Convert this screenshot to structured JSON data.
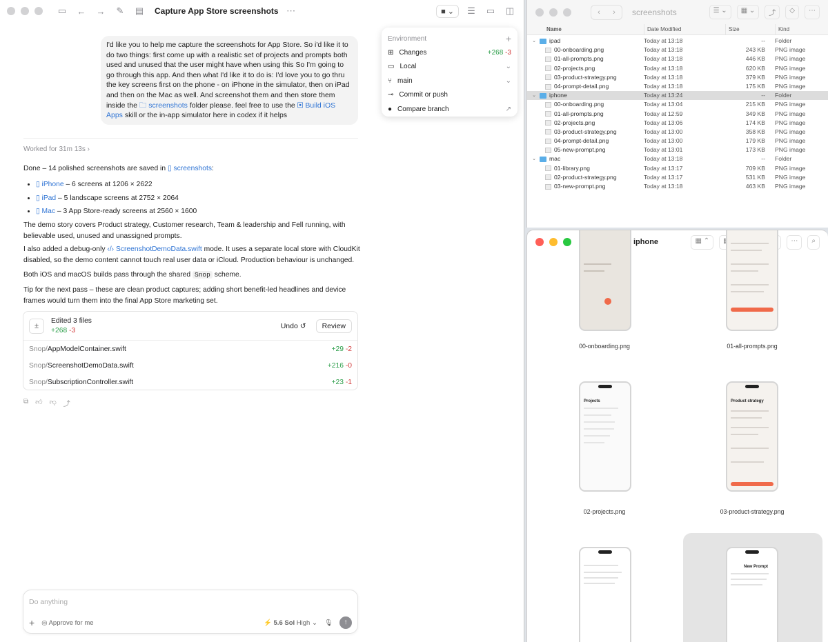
{
  "codex": {
    "window_title": "Capture App Store screenshots",
    "user_message": "I'd like you to help me capture the screenshots for App Store. So i'd like it to do two things: first come up with a realistic set of projects and prompts both used and unused that the user might have when using this So I'm going to go through this app. And then what I'd like it to do is: I'd love you to go thru the key screens first on the phone - on iPhone in the simulator, then on iPad and then on the Mac as well. And screenshot them and then store them inside the",
    "user_folder_chip": "screenshots",
    "user_message_2": "folder please. feel free to use the",
    "user_skill_chip": "Build iOS Apps",
    "user_message_3": "skill or the in-app simulator here in codex if it helps",
    "environment": {
      "header": "Environment",
      "rows": [
        {
          "icon": "changes-icon",
          "label": "Changes",
          "added": "+268",
          "removed": "-3"
        },
        {
          "icon": "laptop-icon",
          "label": "Local",
          "right": "⌄"
        },
        {
          "icon": "branch-icon",
          "label": "main",
          "right": "⌄"
        },
        {
          "icon": "commit-icon",
          "label": "Commit or push",
          "right": ""
        },
        {
          "icon": "github-icon",
          "label": "Compare branch",
          "right": "↗"
        }
      ]
    },
    "worked_for": "Worked for 31m 13s",
    "done_prefix": "Done – 14 polished screenshots are saved in",
    "done_folder": "screenshots",
    "done_suffix": ":",
    "bullets": [
      {
        "link": "iPhone",
        "text": "– 6 screens at 1206 × 2622"
      },
      {
        "link": "iPad",
        "text": "– 5 landscape screens at 2752 × 2064"
      },
      {
        "link": "Mac",
        "text": "– 3 App Store-ready screens at 2560 × 1600"
      }
    ],
    "para_demo": "The demo story covers Product strategy, Customer research, Team & leadership and Fell running, with believable used, unused and unassigned prompts.",
    "para_debug_1": "I also added a debug-only",
    "para_debug_link": "ScreenshotDemoData.swift",
    "para_debug_2": "mode. It uses a separate local store with CloudKit disabled, so the demo content cannot touch real user data or iCloud. Production behaviour is unchanged.",
    "para_builds_1": "Both iOS and macOS builds pass through the shared",
    "para_builds_code": "Snop",
    "para_builds_2": "scheme.",
    "para_tip": "Tip for the next pass – these are clean product captures; adding short benefit-led headlines and device frames would turn them into the final App Store marketing set.",
    "edits": {
      "title": "Edited 3 files",
      "added": "+268",
      "removed": "-3",
      "undo": "Undo",
      "review": "Review",
      "files": [
        {
          "dir": "Snop/",
          "name": "AppModelContainer.swift",
          "added": "+29",
          "removed": "-2"
        },
        {
          "dir": "Snop/",
          "name": "ScreenshotDemoData.swift",
          "added": "+216",
          "removed": "-0"
        },
        {
          "dir": "Snop/",
          "name": "SubscriptionController.swift",
          "added": "+23",
          "removed": "-1"
        }
      ]
    },
    "composer": {
      "placeholder": "Do anything",
      "approve": "Approve for me",
      "model": "5.6 Sol",
      "effort": "High"
    }
  },
  "finder_list": {
    "title": "screenshots",
    "columns": [
      "Name",
      "Date Modified",
      "Size",
      "Kind"
    ],
    "rows": [
      {
        "level": 0,
        "folder": true,
        "name": "ipad",
        "date": "Today at 13:18",
        "size": "--",
        "kind": "Folder"
      },
      {
        "level": 1,
        "folder": false,
        "name": "00-onboarding.png",
        "date": "Today at 13:18",
        "size": "243 KB",
        "kind": "PNG image"
      },
      {
        "level": 1,
        "folder": false,
        "name": "01-all-prompts.png",
        "date": "Today at 13:18",
        "size": "446 KB",
        "kind": "PNG image"
      },
      {
        "level": 1,
        "folder": false,
        "name": "02-projects.png",
        "date": "Today at 13:18",
        "size": "620 KB",
        "kind": "PNG image"
      },
      {
        "level": 1,
        "folder": false,
        "name": "03-product-strategy.png",
        "date": "Today at 13:18",
        "size": "379 KB",
        "kind": "PNG image"
      },
      {
        "level": 1,
        "folder": false,
        "name": "04-prompt-detail.png",
        "date": "Today at 13:18",
        "size": "175 KB",
        "kind": "PNG image"
      },
      {
        "level": 0,
        "folder": true,
        "name": "iphone",
        "date": "Today at 13:24",
        "size": "--",
        "kind": "Folder",
        "selected": true
      },
      {
        "level": 1,
        "folder": false,
        "name": "00-onboarding.png",
        "date": "Today at 13:04",
        "size": "215 KB",
        "kind": "PNG image"
      },
      {
        "level": 1,
        "folder": false,
        "name": "01-all-prompts.png",
        "date": "Today at 12:59",
        "size": "349 KB",
        "kind": "PNG image"
      },
      {
        "level": 1,
        "folder": false,
        "name": "02-projects.png",
        "date": "Today at 13:06",
        "size": "174 KB",
        "kind": "PNG image"
      },
      {
        "level": 1,
        "folder": false,
        "name": "03-product-strategy.png",
        "date": "Today at 13:00",
        "size": "358 KB",
        "kind": "PNG image"
      },
      {
        "level": 1,
        "folder": false,
        "name": "04-prompt-detail.png",
        "date": "Today at 13:00",
        "size": "179 KB",
        "kind": "PNG image"
      },
      {
        "level": 1,
        "folder": false,
        "name": "05-new-prompt.png",
        "date": "Today at 13:01",
        "size": "173 KB",
        "kind": "PNG image"
      },
      {
        "level": 0,
        "folder": true,
        "name": "mac",
        "date": "Today at 13:18",
        "size": "--",
        "kind": "Folder"
      },
      {
        "level": 1,
        "folder": false,
        "name": "01-library.png",
        "date": "Today at 13:17",
        "size": "709 KB",
        "kind": "PNG image"
      },
      {
        "level": 1,
        "folder": false,
        "name": "02-product-strategy.png",
        "date": "Today at 13:17",
        "size": "531 KB",
        "kind": "PNG image"
      },
      {
        "level": 1,
        "folder": false,
        "name": "03-new-prompt.png",
        "date": "Today at 13:18",
        "size": "463 KB",
        "kind": "PNG image"
      }
    ]
  },
  "finder_icons": {
    "title": "iphone",
    "items": [
      {
        "label": "00-onboarding.png",
        "screen_title": ""
      },
      {
        "label": "01-all-prompts.png",
        "screen_title": ""
      },
      {
        "label": "02-projects.png",
        "screen_title": "Projects"
      },
      {
        "label": "03-product-strategy.png",
        "screen_title": "Product strategy"
      },
      {
        "label": "",
        "screen_title": ""
      },
      {
        "label": "",
        "screen_title": "New Prompt"
      }
    ]
  }
}
